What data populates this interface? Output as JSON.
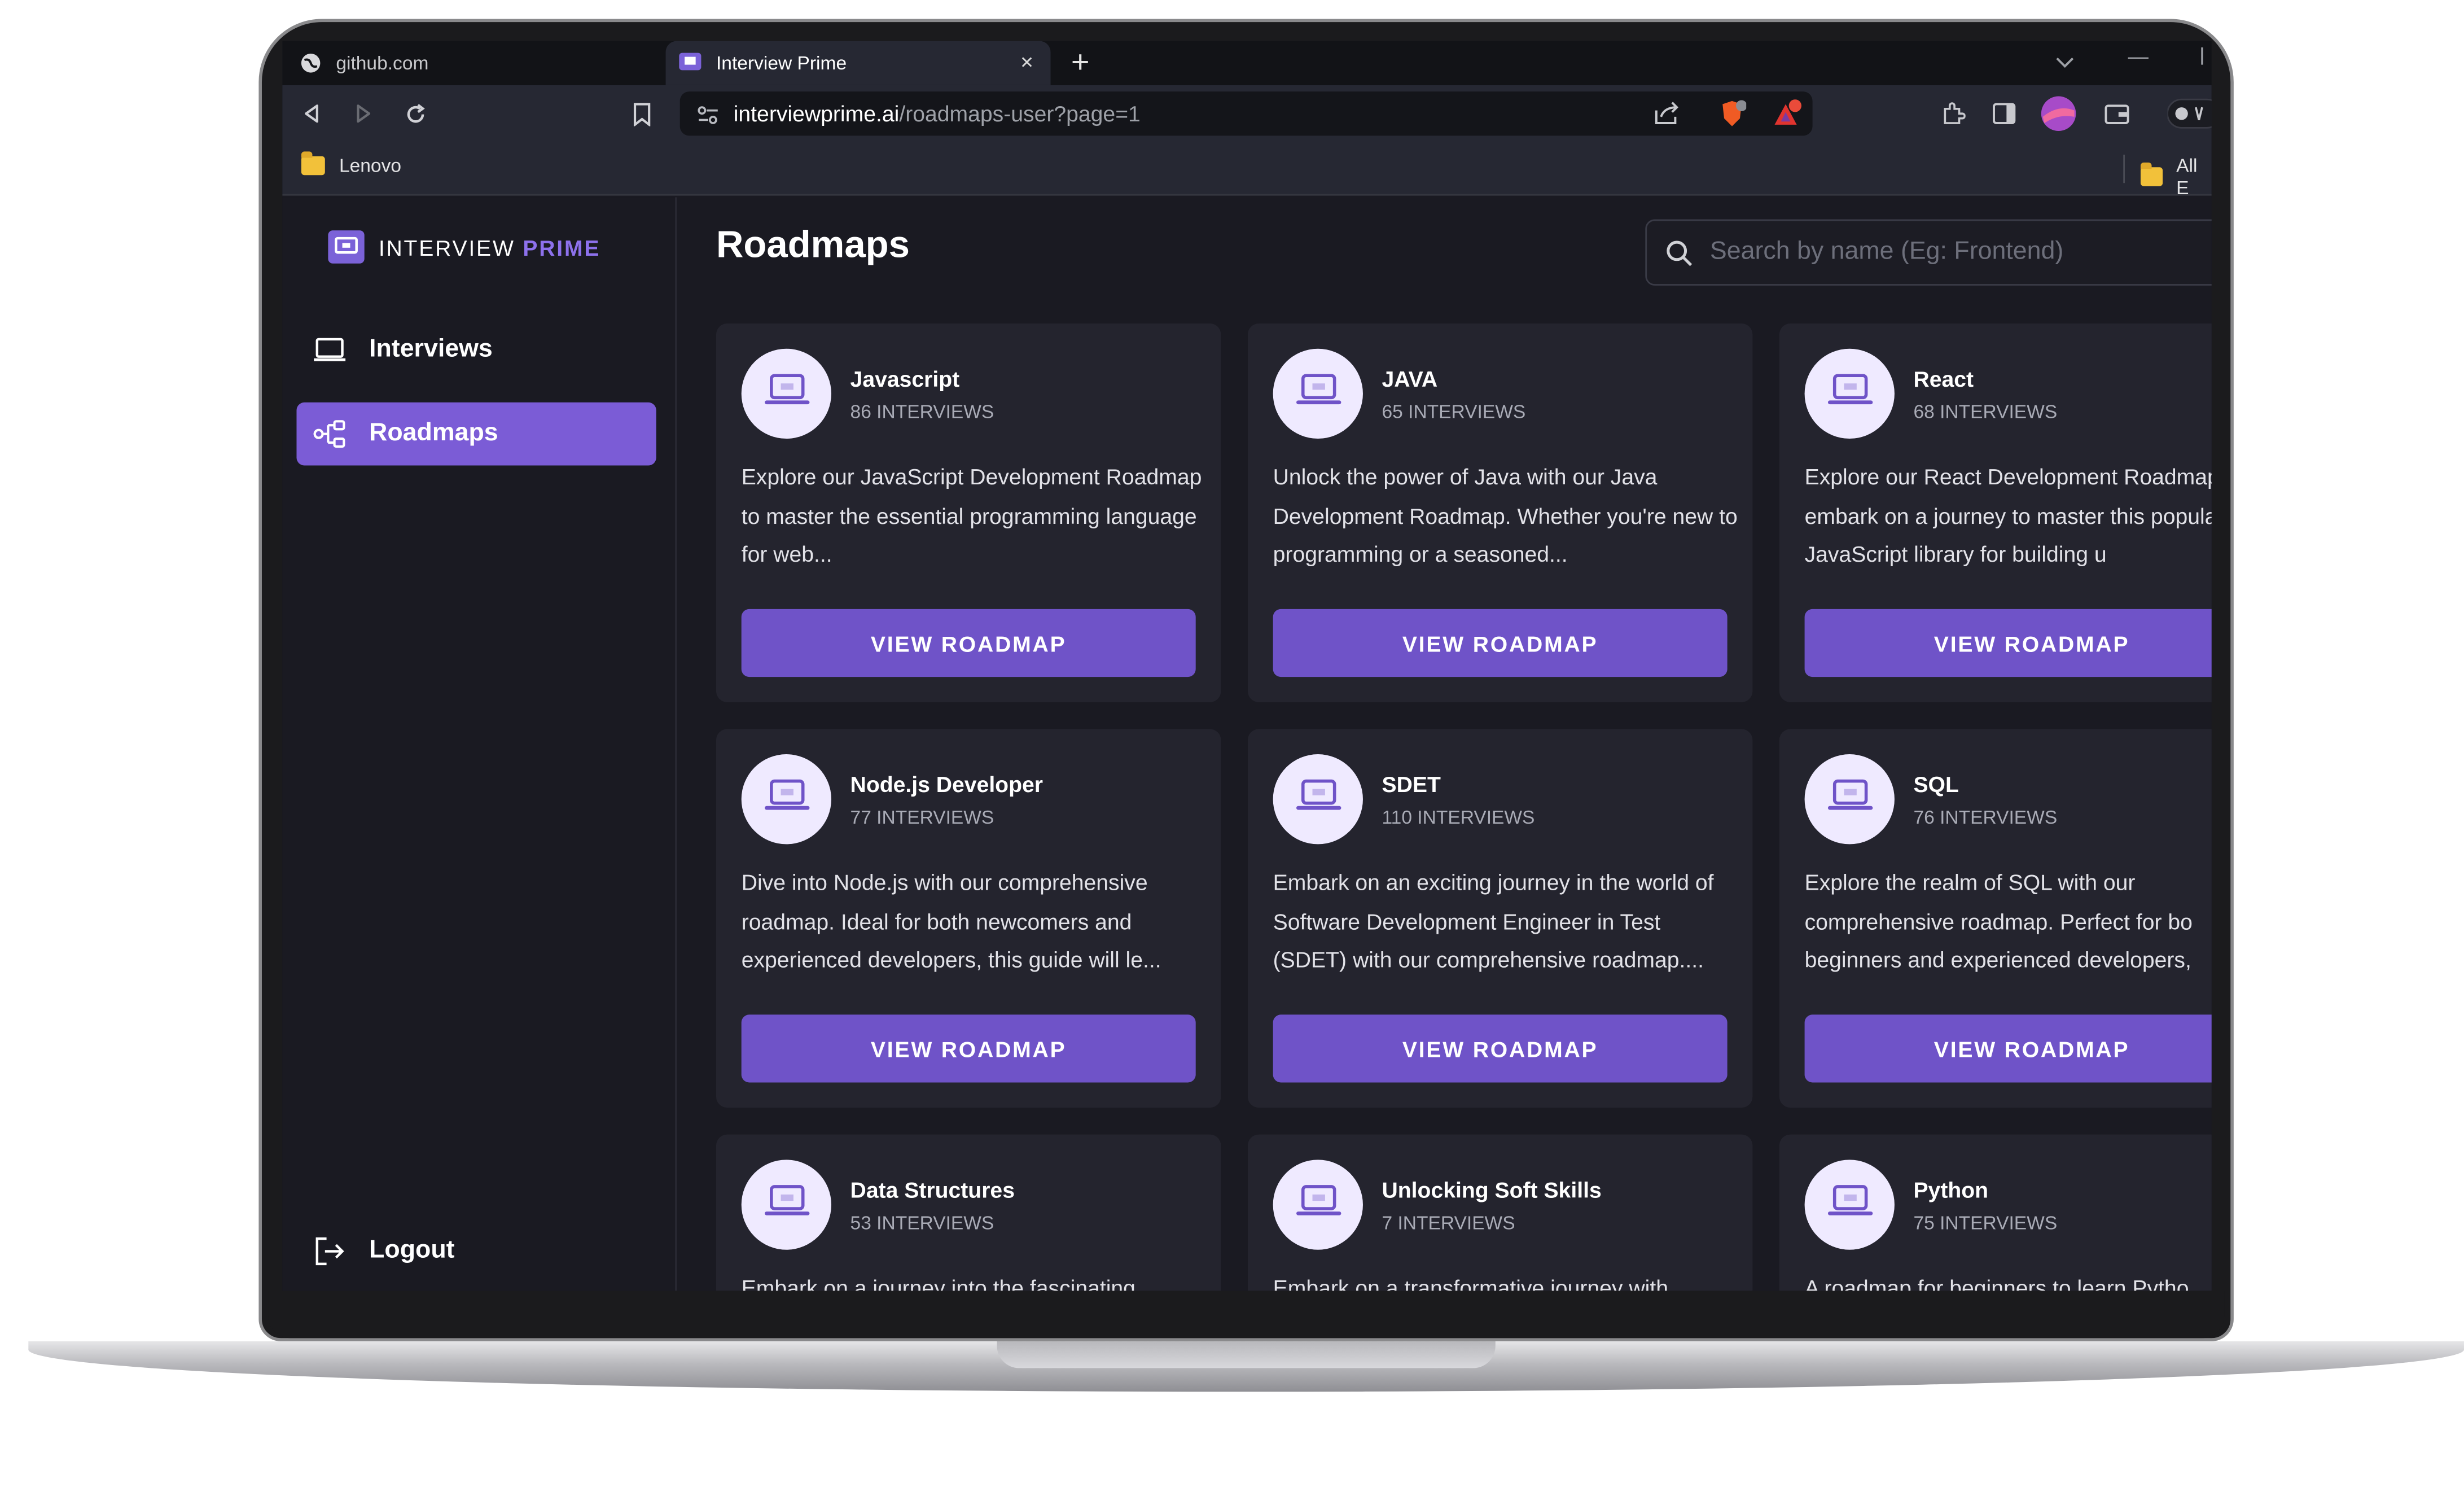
{
  "browser": {
    "tabs": [
      {
        "label": "github.com",
        "active": false
      },
      {
        "label": "Interview Prime",
        "active": true
      }
    ],
    "url_host": "interviewprime.ai",
    "url_path": "/roadmaps-user?page=1",
    "bookmarks": {
      "left": "Lenovo",
      "right": "All E"
    }
  },
  "colors": {
    "accent": "#7b5cd6",
    "button": "#6f53c8",
    "background": "#1a1a22",
    "card": "#24242e"
  },
  "sidebar": {
    "logo_word1": "INTERVIEW",
    "logo_word2": "PRIME",
    "items": [
      {
        "label": "Interviews",
        "icon": "laptop-icon",
        "active": false
      },
      {
        "label": "Roadmaps",
        "icon": "roadmap-icon",
        "active": true
      }
    ],
    "logout": "Logout"
  },
  "main": {
    "title": "Roadmaps",
    "search_placeholder": "Search by name (Eg: Frontend)",
    "button_label": "VIEW ROADMAP",
    "cards": [
      {
        "title": "Javascript",
        "count": "86 INTERVIEWS",
        "desc": "Explore our JavaScript Development Roadmap to master the essential programming language for web..."
      },
      {
        "title": "JAVA",
        "count": "65 INTERVIEWS",
        "desc": "Unlock the power of Java with our Java Development Roadmap. Whether you're new to programming or a seasoned..."
      },
      {
        "title": "React",
        "count": "68 INTERVIEWS",
        "desc": "Explore our React Development Roadmap and embark on a journey to master this popular JavaScript library for building u"
      },
      {
        "title": "Node.js Developer",
        "count": "77 INTERVIEWS",
        "desc": "Dive into Node.js with our comprehensive roadmap. Ideal for both newcomers and experienced developers, this guide will le..."
      },
      {
        "title": "SDET",
        "count": "110 INTERVIEWS",
        "desc": "Embark on an exciting journey in the world of Software Development Engineer in Test (SDET) with our comprehensive roadmap...."
      },
      {
        "title": "SQL",
        "count": "76 INTERVIEWS",
        "desc": "Explore the realm of SQL with our comprehensive roadmap. Perfect for bo beginners and experienced developers,"
      },
      {
        "title": "Data Structures",
        "count": "53 INTERVIEWS",
        "desc": "Embark on a journey into the fascinating"
      },
      {
        "title": "Unlocking Soft Skills",
        "count": "7 INTERVIEWS",
        "desc": "Embark on a transformative journey with"
      },
      {
        "title": "Python",
        "count": "75 INTERVIEWS",
        "desc": "A roadmap for beginners to learn Pytho"
      }
    ]
  }
}
